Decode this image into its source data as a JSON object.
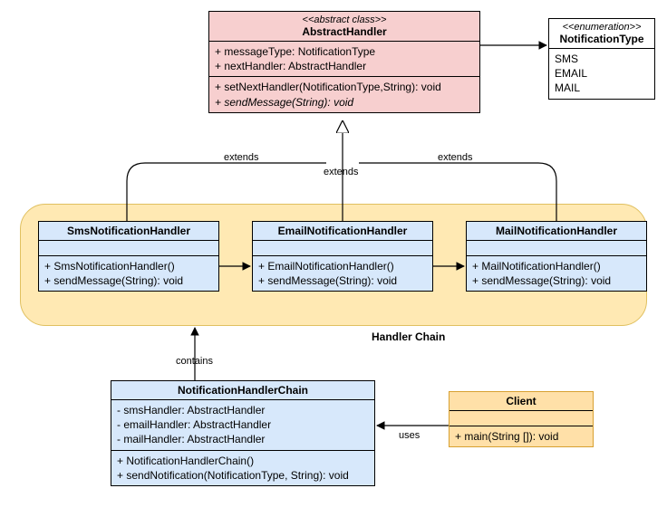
{
  "abstract": {
    "stereo": "<<abstract class>>",
    "name": "AbstractHandler",
    "attrs": [
      "+ messageType: NotificationType",
      "+ nextHandler: AbstractHandler"
    ],
    "ops": [
      "+ setNextHandler(NotificationType,String): void",
      "+ sendMessage(String): void"
    ]
  },
  "enum": {
    "stereo": "<<enumeration>>",
    "name": "NotificationType",
    "values": [
      "SMS",
      "EMAIL",
      "MAIL"
    ]
  },
  "handlers": {
    "sms": {
      "name": "SmsNotificationHandler",
      "ops": [
        "+ SmsNotificationHandler()",
        "+ sendMessage(String): void"
      ]
    },
    "email": {
      "name": "EmailNotificationHandler",
      "ops": [
        "+ EmailNotificationHandler()",
        "+ sendMessage(String): void"
      ]
    },
    "mail": {
      "name": "MailNotificationHandler",
      "ops": [
        "+ MailNotificationHandler()",
        "+ sendMessage(String): void"
      ]
    }
  },
  "chain": {
    "title": "Handler Chain",
    "className": "NotificationHandlerChain",
    "attrs": [
      "- smsHandler: AbstractHandler",
      "- emailHandler: AbstractHandler",
      "- mailHandler: AbstractHandler"
    ],
    "ops": [
      "+ NotificationHandlerChain()",
      "+ sendNotification(NotificationType, String): void"
    ]
  },
  "client": {
    "name": "Client",
    "ops": [
      "+ main(String []): void"
    ]
  },
  "rel": {
    "extends1": "extends",
    "extends2": "extends",
    "extends3": "extends",
    "contains": "contains",
    "uses": "uses"
  }
}
